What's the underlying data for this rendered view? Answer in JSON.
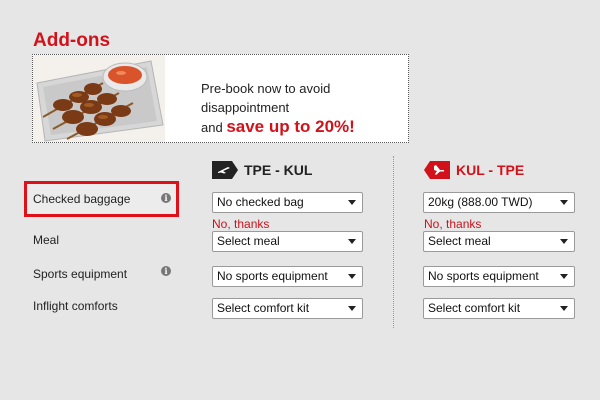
{
  "section": {
    "title": "Add-ons"
  },
  "banner": {
    "line1": "Pre-book now to avoid disappointment",
    "line2_prefix": "and ",
    "line2_highlight": "save up to 20%!"
  },
  "routes": {
    "outbound": "TPE - KUL",
    "return": "KUL - TPE"
  },
  "rows": {
    "checked_baggage": "Checked baggage",
    "meal": "Meal",
    "sports": "Sports equipment",
    "comforts": "Inflight comforts"
  },
  "outbound": {
    "baggage": "No checked bag",
    "baggage_note": "No, thanks",
    "meal": "Select meal",
    "sports": "No sports equipment",
    "comfort": "Select comfort kit"
  },
  "return": {
    "baggage": "20kg (888.00 TWD)",
    "baggage_note": "No, thanks",
    "meal": "Select meal",
    "sports": "No sports equipment",
    "comfort": "Select comfort kit"
  },
  "colors": {
    "accent": "#d2121b",
    "background": "#e6e6e6"
  },
  "icons": {
    "info": "info-icon",
    "plane_depart": "plane-depart-icon",
    "plane_arrive": "plane-arrive-icon"
  }
}
